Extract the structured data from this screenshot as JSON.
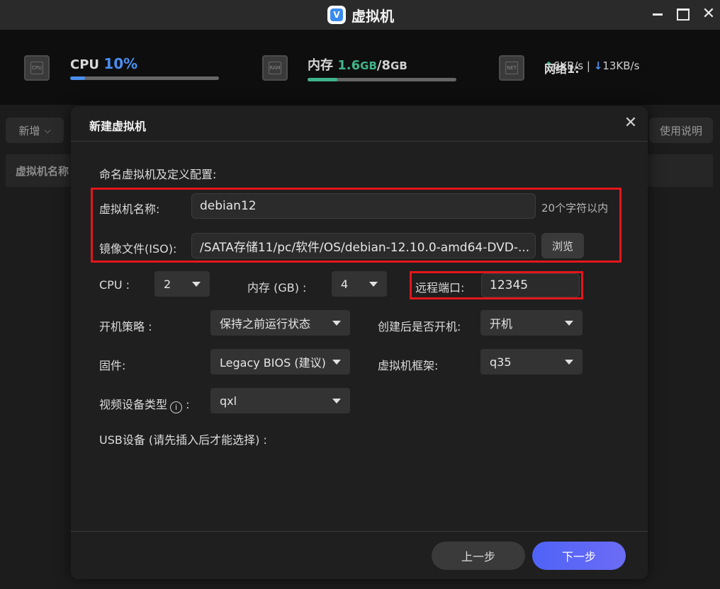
{
  "titlebar": {
    "app_title": "虚拟机",
    "app_icon": "v-logo-icon",
    "close_glyph": "✕"
  },
  "stats": {
    "cpu": {
      "icon_text": "CPU",
      "label": "CPU",
      "value": "10%",
      "usage": 0.1
    },
    "memory": {
      "icon_text": "RAM",
      "label": "内存",
      "used": "1.6",
      "used_unit": "GB",
      "sep": "/",
      "total": "8",
      "total_unit": "GB",
      "usage": 0.2
    },
    "network": {
      "icon_text": "NET",
      "label": "网络1:",
      "up_arrow": "↑",
      "up": "6KB/s",
      "sep": " | ",
      "down_arrow": "↓",
      "down": "13KB/s"
    }
  },
  "background": {
    "new_button": "新增",
    "help_button": "使用说明",
    "table_col": "虚拟机名称"
  },
  "dialog": {
    "title": "新建虚拟机",
    "close_glyph": "✕",
    "subtitle": "命名虚拟机及定义配置:",
    "vm_name": {
      "label": "虚拟机名称:",
      "value": "debian12",
      "hint": "20个字符以内"
    },
    "iso": {
      "label": "镜像文件(ISO):",
      "value": "/SATA存储11/pc/软件/OS/debian-12.10.0-amd64-DVD-...",
      "browse": "浏览"
    },
    "cpu": {
      "label": "CPU :",
      "value": "2"
    },
    "memory": {
      "label": "内存 (GB) :",
      "value": "4"
    },
    "remote_port": {
      "label": "远程端口:",
      "value": "12345"
    },
    "boot_policy": {
      "label": "开机策略 :",
      "value": "保持之前运行状态"
    },
    "boot_after_create": {
      "label": "创建后是否开机:",
      "value": "开机"
    },
    "firmware": {
      "label": "固件:",
      "value": "Legacy BIOS (建议)"
    },
    "machine_type": {
      "label": "虚拟机框架:",
      "value": "q35"
    },
    "video": {
      "label": "视频设备类型",
      "info_glyph": "i",
      "label_suffix": " :",
      "value": "qxl"
    },
    "usb": {
      "label": "USB设备 (请先插入后才能选择) :"
    },
    "prev_button": "上一步",
    "next_button": "下一步"
  },
  "colors": {
    "accent_blue": "#4a8ef0",
    "accent_green": "#3fb48a",
    "highlight_red": "#e3161b",
    "primary_button": "#5865f6"
  }
}
